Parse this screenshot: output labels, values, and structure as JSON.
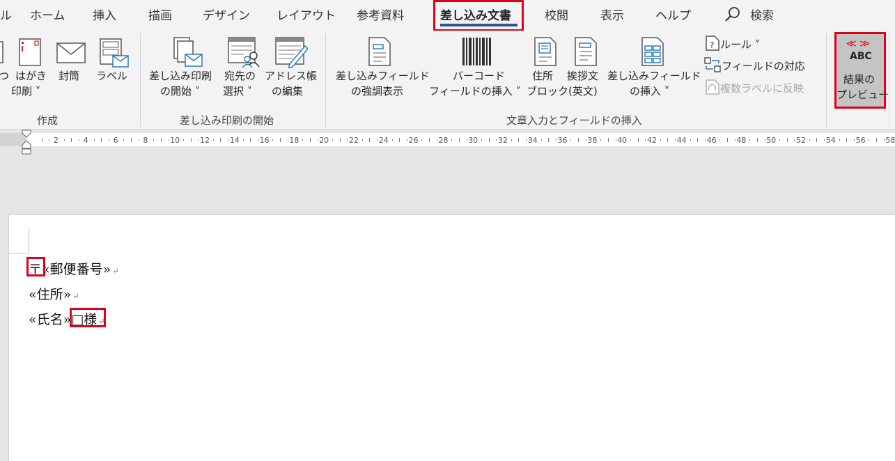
{
  "tabs": [
    "ル",
    "ホーム",
    "挿入",
    "描画",
    "デザイン",
    "レイアウト",
    "参考資料",
    "差し込み文書",
    "校閲",
    "表示",
    "ヘルプ"
  ],
  "search_label": "検索",
  "ribbon": {
    "create_group": {
      "label": "作成",
      "partial_label": "つ",
      "hagaki_1": "はがき",
      "hagaki_2": "印刷 ˅",
      "envelope": "封筒",
      "label_btn": "ラベル"
    },
    "start_group": {
      "label": "差し込み印刷の開始",
      "start_1": "差し込み印刷",
      "start_2": "の開始 ˅",
      "recip_1": "宛先の",
      "recip_2": "選択 ˅",
      "edit_1": "アドレス帳",
      "edit_2": "の編集"
    },
    "fields_group": {
      "label": "文章入力とフィールドの挿入",
      "highlight_1": "差し込みフィールド",
      "highlight_2": "の強調表示",
      "barcode_1": "バーコード",
      "barcode_2": "フィールドの挿入 ˅",
      "address_1": "住所",
      "address_2": "ブロック",
      "greeting_1": "挨拶文",
      "greeting_2": "(英文)",
      "insert_1": "差し込みフィールド",
      "insert_2": "の挿入 ˅",
      "rules": "ルール ˅",
      "match": "フィールドの対応",
      "update": "複数ラベルに反映"
    },
    "preview": {
      "icon_text": "ABC",
      "icon_arrows": "≪ ≫",
      "label_1": "結果の",
      "label_2": "プレビュー"
    }
  },
  "ruler_ticks": [
    "2",
    "4",
    "6",
    "8",
    "10",
    "12",
    "14",
    "16",
    "18",
    "20",
    "22",
    "24",
    "26",
    "28",
    "30",
    "32",
    "34",
    "36",
    "38",
    "40",
    "42",
    "44",
    "46",
    "48",
    "50",
    "52",
    "54",
    "56",
    "58"
  ],
  "document": {
    "line1_prefix": "〒",
    "line1_field": "«郵便番号»",
    "line2_field": "«住所»",
    "line3_field": "«氏名»",
    "line3_suffix": "□様",
    "para_mark": "↵"
  }
}
